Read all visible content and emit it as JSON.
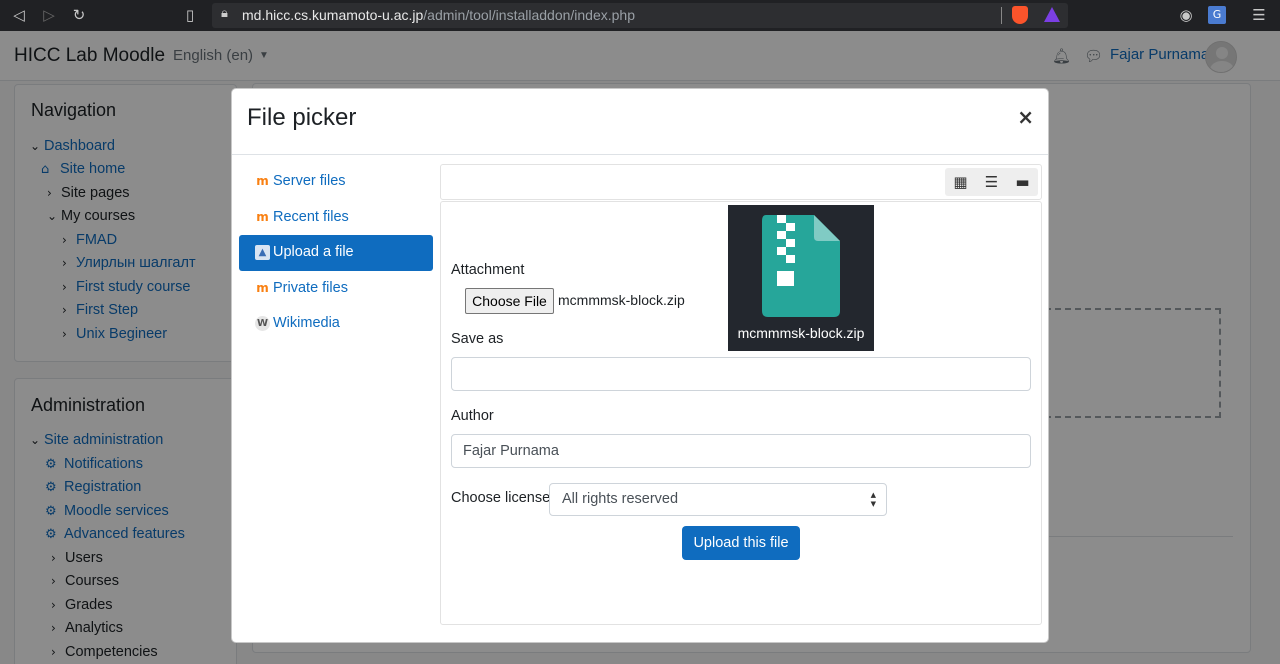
{
  "browser": {
    "url_host": "md.hicc.cs.kumamoto-u.ac.jp",
    "url_path": "/admin/tool/installaddon/index.php",
    "icons": [
      "back-icon",
      "forward-icon",
      "reload-icon",
      "bookmark-icon",
      "lock-icon",
      "brave-shield-icon",
      "brave-rewards-icon",
      "media-icon",
      "translate-icon",
      "menu-icon"
    ]
  },
  "navbar": {
    "brand": "HICC Lab Moodle",
    "language": "English (en)",
    "user_name": "Fajar Purnama"
  },
  "navigation": {
    "title": "Navigation",
    "items": [
      {
        "label": "Dashboard",
        "icon": "chevron-down-icon"
      },
      {
        "label": "Site home",
        "icon": "home-icon"
      },
      {
        "label": "Site pages",
        "icon": "chevron-right-icon"
      },
      {
        "label": "My courses",
        "icon": "chevron-down-icon"
      },
      {
        "label": "FMAD",
        "icon": "chevron-right-icon"
      },
      {
        "label": "Улирлын шалгалт",
        "icon": "chevron-right-icon"
      },
      {
        "label": "First study course",
        "icon": "chevron-right-icon"
      },
      {
        "label": "First Step",
        "icon": "chevron-right-icon"
      },
      {
        "label": "Unix Begineer",
        "icon": "chevron-right-icon"
      }
    ]
  },
  "administration": {
    "title": "Administration",
    "items": [
      {
        "label": "Site administration",
        "icon": "chevron-down-icon"
      },
      {
        "label": "Notifications",
        "icon": "gear-icon"
      },
      {
        "label": "Registration",
        "icon": "gear-icon"
      },
      {
        "label": "Moodle services",
        "icon": "gear-icon"
      },
      {
        "label": "Advanced features",
        "icon": "gear-icon"
      },
      {
        "label": "Users",
        "icon": "chevron-right-icon"
      },
      {
        "label": "Courses",
        "icon": "chevron-right-icon"
      },
      {
        "label": "Grades",
        "icon": "chevron-right-icon"
      },
      {
        "label": "Analytics",
        "icon": "chevron-right-icon"
      },
      {
        "label": "Competencies",
        "icon": "chevron-right-icon"
      }
    ]
  },
  "file_picker": {
    "title": "File picker",
    "close_label": "×",
    "repositories": [
      {
        "label": "Server files",
        "icon": "moodle-icon"
      },
      {
        "label": "Recent files",
        "icon": "moodle-icon"
      },
      {
        "label": "Upload a file",
        "icon": "upload-icon",
        "active": true
      },
      {
        "label": "Private files",
        "icon": "moodle-icon"
      },
      {
        "label": "Wikimedia",
        "icon": "wikimedia-icon"
      }
    ],
    "view_modes": [
      "grid-view-icon",
      "list-view-icon",
      "folder-view-icon"
    ],
    "attachment_label": "Attachment",
    "choose_file_label": "Choose File",
    "chosen_file": "mcmmmsk-block.zip",
    "save_as_label": "Save as",
    "save_as_value": "",
    "author_label": "Author",
    "author_value": "Fajar Purnama",
    "license_label": "Choose license",
    "license_value": "All rights reserved",
    "upload_button": "Upload this file",
    "preview_name": "mcmmmsk-block.zip",
    "preview_color": "#26a69a"
  }
}
